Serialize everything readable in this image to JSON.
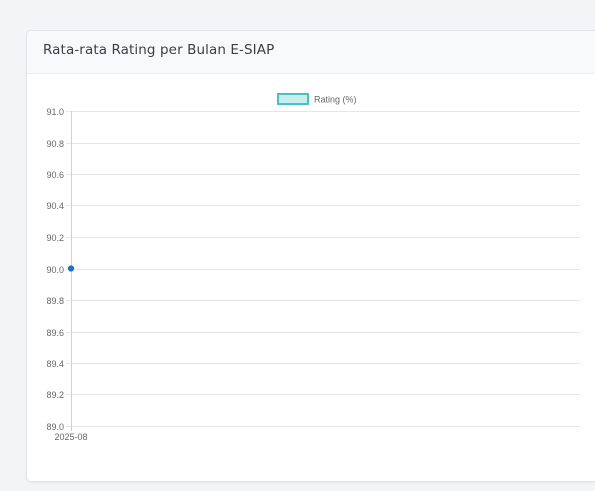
{
  "card": {
    "title": "Rata-rata Rating per Bulan E-SIAP"
  },
  "chart_data": {
    "type": "line",
    "title": "",
    "xlabel": "",
    "ylabel": "",
    "categories": [
      "2025-08"
    ],
    "series": [
      {
        "name": "Rating (%)",
        "values": [
          90.0
        ],
        "color": "#4bc0c0",
        "fill": "#c9eeee",
        "point_color": "#1e73be"
      }
    ],
    "ylim": [
      89.0,
      91.0
    ],
    "yticks": [
      "91.0",
      "90.8",
      "90.6",
      "90.4",
      "90.2",
      "90.0",
      "89.8",
      "89.6",
      "89.4",
      "89.2",
      "89.0"
    ],
    "grid": true,
    "legend": "top-center"
  }
}
